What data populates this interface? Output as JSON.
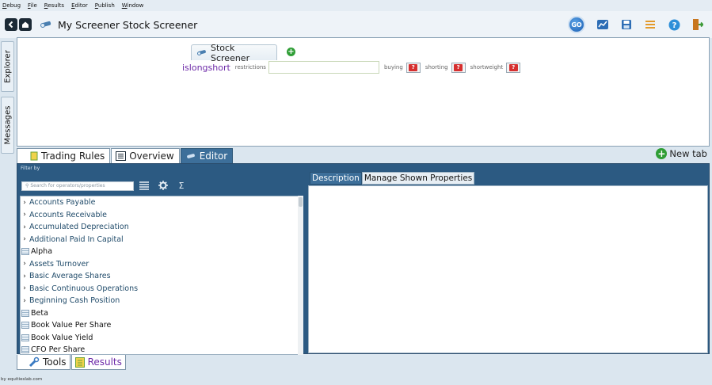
{
  "menu": [
    "Debug",
    "File",
    "Results",
    "Editor",
    "Publish",
    "Window"
  ],
  "title": "My Screener Stock Screener",
  "toolbar": {
    "go_label": "GO"
  },
  "vtabs": {
    "explorer": "Explorer",
    "messages": "Messages"
  },
  "editor": {
    "tab_label": "Stock Screener",
    "rule_name": "islongshort",
    "restrictions_label": "restrictions",
    "restrictions_value": "",
    "buying_label": "buying",
    "shorting_label": "shorting",
    "shortweight_label": "shortweight",
    "question_mark": "?"
  },
  "lower_tabs": [
    "Trading Rules",
    "Overview",
    "Editor"
  ],
  "new_tab_label": "New tab",
  "filter": {
    "title": "Filter by",
    "search_placeholder": "Search for operators/properties",
    "sigma": "Σ"
  },
  "list_items": [
    {
      "label": "Accounts Payable",
      "type": "group"
    },
    {
      "label": "Accounts Receivable",
      "type": "group"
    },
    {
      "label": "Accumulated Depreciation",
      "type": "group"
    },
    {
      "label": "Additional Paid In Capital",
      "type": "group"
    },
    {
      "label": "Alpha",
      "type": "leaf"
    },
    {
      "label": "Assets Turnover",
      "type": "group"
    },
    {
      "label": "Basic Average Shares",
      "type": "group"
    },
    {
      "label": "Basic Continuous Operations",
      "type": "group"
    },
    {
      "label": "Beginning Cash Position",
      "type": "group"
    },
    {
      "label": "Beta",
      "type": "leaf"
    },
    {
      "label": "Book Value Per Share",
      "type": "leaf"
    },
    {
      "label": "Book Value Yield",
      "type": "leaf"
    },
    {
      "label": "CFO Per Share",
      "type": "leaf"
    }
  ],
  "right_tabs": [
    "Description",
    "Manage Shown Properties"
  ],
  "bottom_tabs": [
    "Tools",
    "Results"
  ],
  "footer": "by equitieslab.com"
}
